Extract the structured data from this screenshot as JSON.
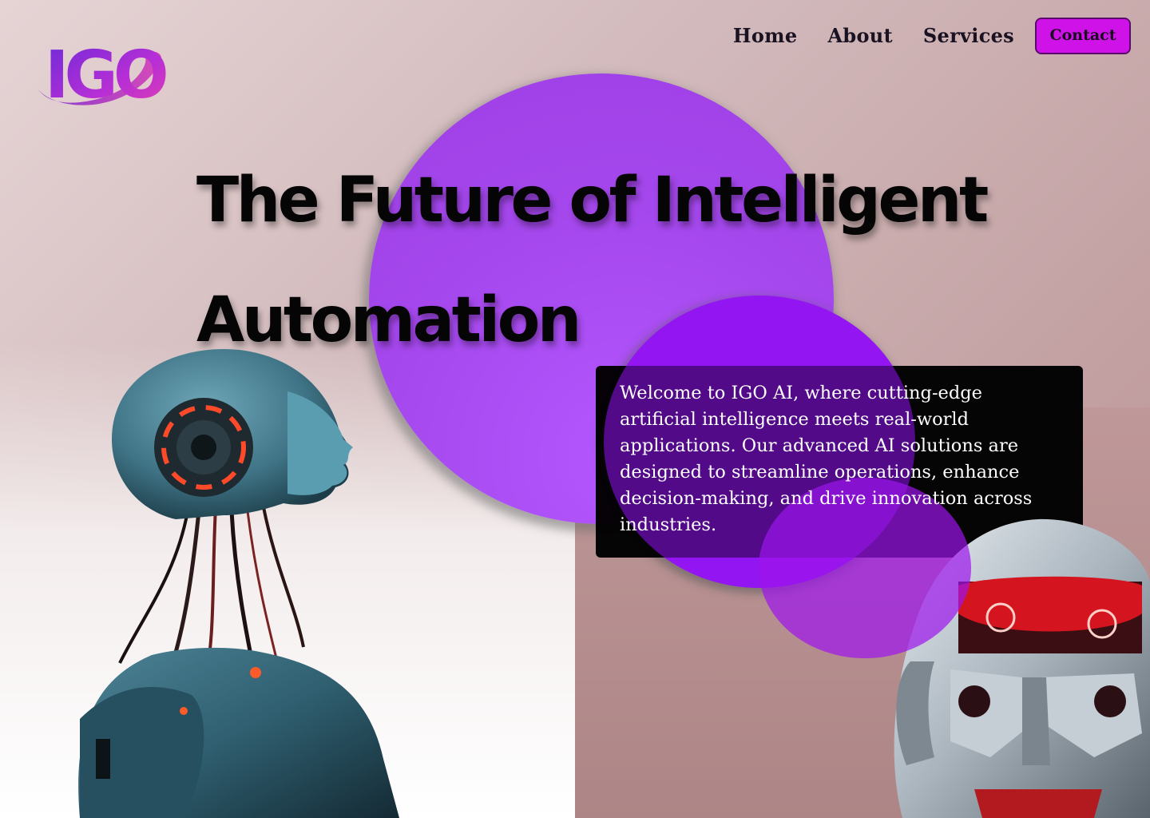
{
  "brand": {
    "logo_text": "IGO"
  },
  "nav": {
    "items": [
      "Home",
      "About",
      "Services"
    ],
    "contact_label": "Contact"
  },
  "hero": {
    "headline_line1": "The Future of Intelligent",
    "headline_line2": "Automation",
    "welcome": "Welcome to IGO AI, where cutting-edge artificial intelligence meets real-world applications. Our advanced AI solutions are designed to streamline operations, enhance decision-making, and drive innovation across industries."
  },
  "colors": {
    "accent": "#cf12e8",
    "circle_purple": "#a447ec",
    "deep_purple": "#9419f0",
    "robot_glow": "#ff3b2a"
  },
  "images": {
    "left": "humanoid-robot-profile",
    "right": "red-eyed-robot-head"
  }
}
